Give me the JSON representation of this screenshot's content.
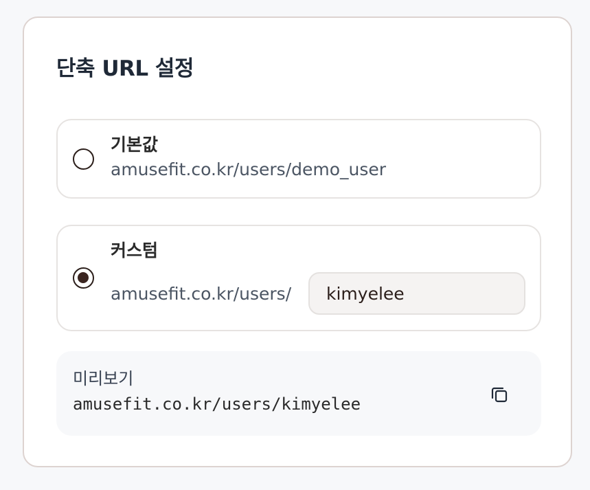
{
  "settings": {
    "title": "단축 URL 설정",
    "options": [
      {
        "label": "기본값",
        "url": "amusefit.co.kr/users/demo_user",
        "selected": false
      },
      {
        "label": "커스텀",
        "url_prefix": "amusefit.co.kr/users/",
        "input_value": "kimyelee",
        "selected": true
      }
    ],
    "preview": {
      "label": "미리보기",
      "url": "amusefit.co.kr/users/kimyelee",
      "copy_icon": "copy-icon"
    }
  },
  "colors": {
    "accent": "#3a2520",
    "border": "#ddd3d0",
    "preview_bg": "#f7f8fa",
    "input_bg": "#f5f3f2"
  }
}
